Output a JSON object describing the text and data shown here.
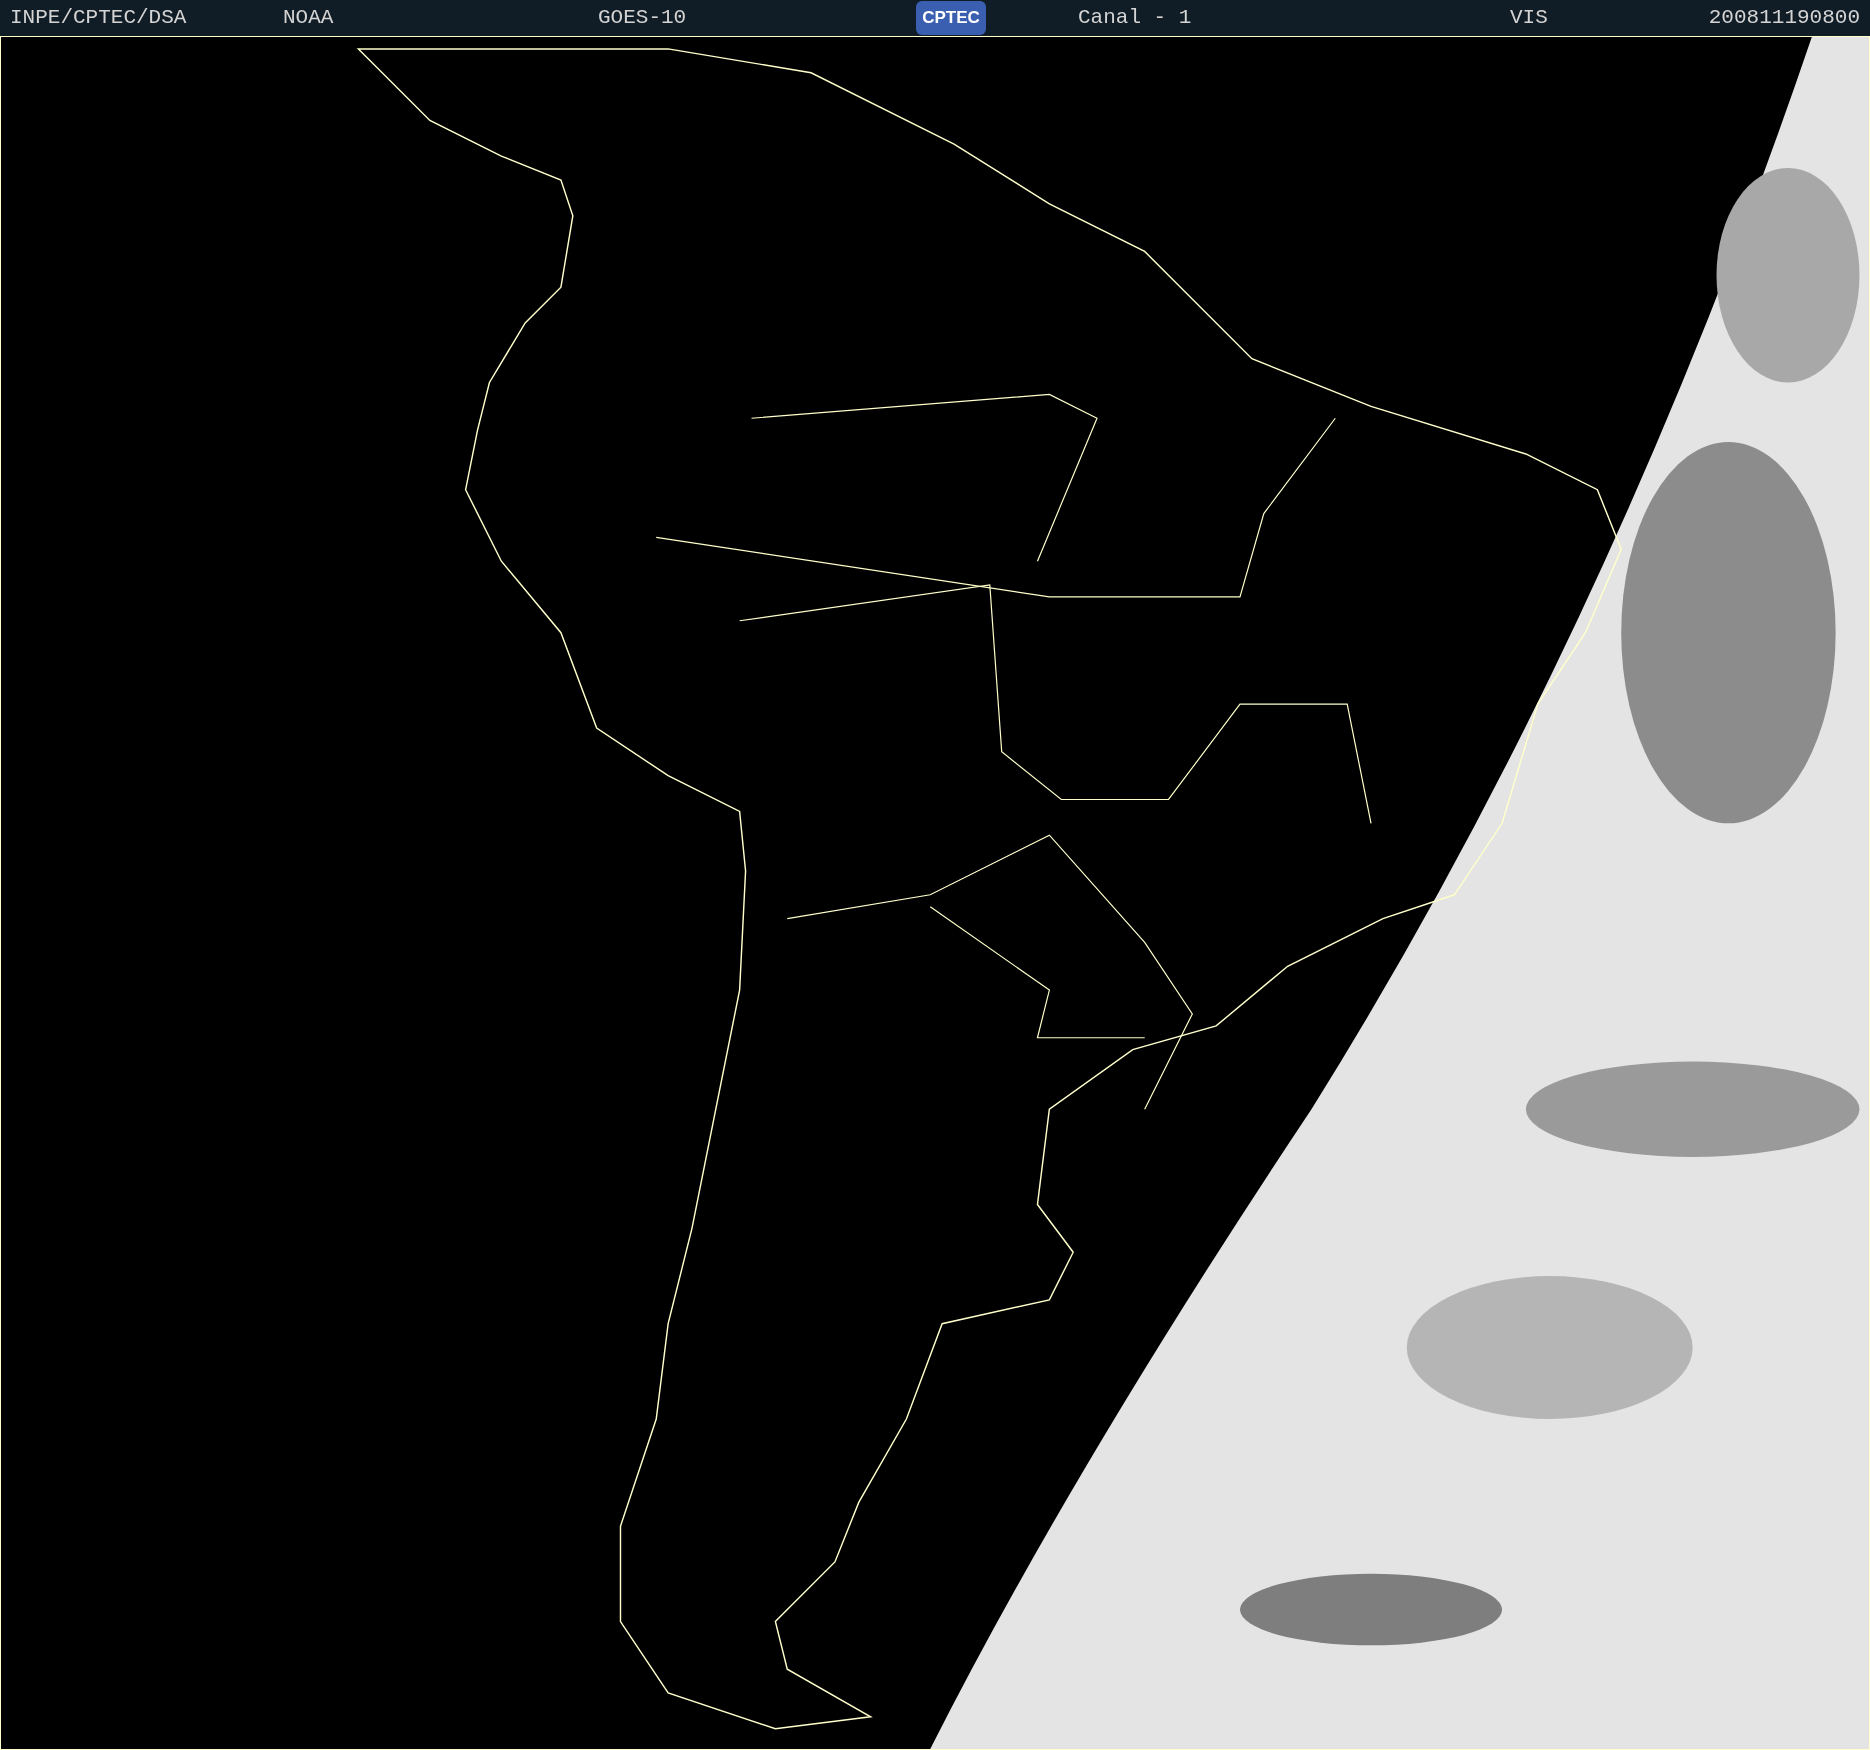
{
  "header": {
    "source": "INPE/CPTEC/DSA",
    "agency": "NOAA",
    "satellite": "GOES-10",
    "logo": "CPTEC",
    "channel": "Canal - 1",
    "band": "VIS",
    "timestamp": "200811190800"
  }
}
